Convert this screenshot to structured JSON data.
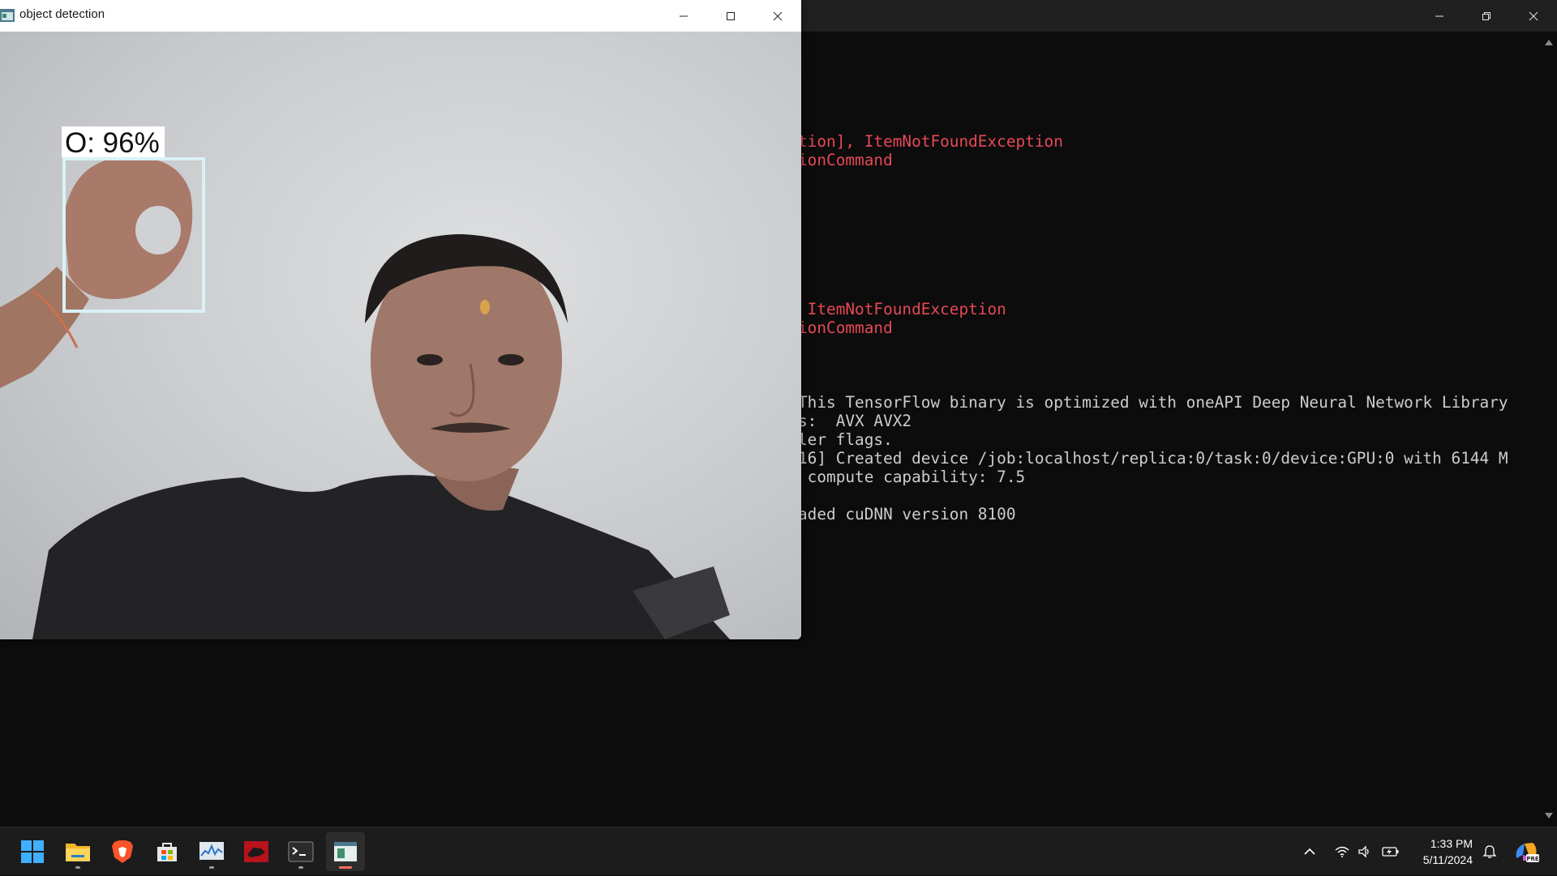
{
  "terminal": {
    "lines": [
      {
        "text": "tion], ItemNotFoundException",
        "color": "red"
      },
      {
        "text": "ionCommand",
        "color": "red"
      },
      {
        "text": " ItemNotFoundException",
        "color": "red"
      },
      {
        "text": "ionCommand",
        "color": "red"
      },
      {
        "text": "This TensorFlow binary is optimized with oneAPI Deep Neural Network Library",
        "color": "white"
      },
      {
        "text": "s:  AVX AVX2",
        "color": "white"
      },
      {
        "text": "ler flags.",
        "color": "white"
      },
      {
        "text": "16] Created device /job:localhost/replica:0/task:0/device:GPU:0 with 6144 M",
        "color": "white"
      },
      {
        "text": " compute capability: 7.5",
        "color": "white"
      },
      {
        "text": "aded cuDNN version 8100",
        "color": "white"
      }
    ]
  },
  "detection_window": {
    "title": "object detection",
    "detection": {
      "label": "O: 96%"
    }
  },
  "taskbar": {
    "apps": [
      {
        "name": "start-button",
        "icon": "windows-logo-icon"
      },
      {
        "name": "file-explorer",
        "icon": "folder-icon",
        "running": true
      },
      {
        "name": "brave-browser",
        "icon": "brave-lion-icon"
      },
      {
        "name": "microsoft-store",
        "icon": "store-bag-icon"
      },
      {
        "name": "resource-monitor",
        "icon": "chart-monitor-icon",
        "running": true
      },
      {
        "name": "red-app",
        "icon": "red-app-icon"
      },
      {
        "name": "terminal",
        "icon": "terminal-icon",
        "running": true
      },
      {
        "name": "object-detection",
        "icon": "python-window-icon",
        "running": true,
        "active": true
      }
    ],
    "clock": {
      "time": "1:33 PM",
      "date": "5/11/2024"
    },
    "tray_icons": [
      "chevron-up-icon",
      "wifi-icon",
      "speaker-icon",
      "battery-charging-icon",
      "notification-icon",
      "copilot-icon"
    ],
    "copilot_badge": "PRE"
  },
  "colors": {
    "terminal_error": "#e74856",
    "terminal_text": "#cccccc",
    "terminal_bg": "#0c0c0c",
    "taskbar_bg": "#1c1c1c",
    "active_indicator": "#ff6f59",
    "detection_box": "#d9f2f7"
  }
}
